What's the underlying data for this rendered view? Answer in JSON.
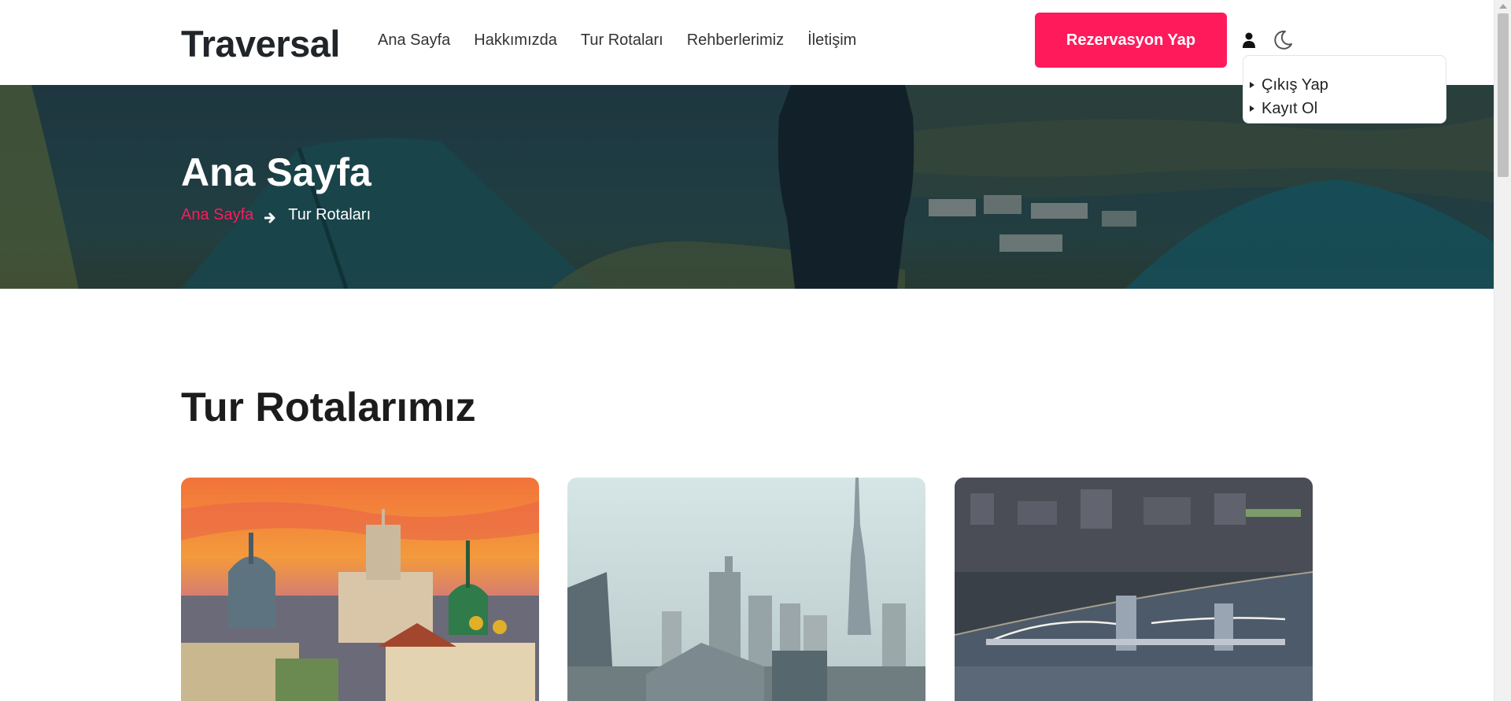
{
  "brand": {
    "name": "Traversal"
  },
  "nav": {
    "links": [
      {
        "label": "Ana Sayfa"
      },
      {
        "label": "Hakkımızda"
      },
      {
        "label": "Tur Rotaları"
      },
      {
        "label": "Rehberlerimiz"
      },
      {
        "label": "İletişim"
      }
    ],
    "reserve_label": "Rezervasyon Yap",
    "user_icon": "user-icon",
    "theme_icon": "moon-icon"
  },
  "user_menu": {
    "items": [
      {
        "label": "Çıkış Yap"
      },
      {
        "label": "Kayıt Ol"
      }
    ]
  },
  "hero": {
    "title": "Ana Sayfa",
    "breadcrumb": {
      "home": "Ana Sayfa",
      "current": "Tur Rotaları",
      "separator_icon": "arrow-right-icon"
    }
  },
  "section": {
    "title": "Tur Rotalarımız"
  },
  "tour_cards": [
    {
      "image": "city-sunset-domes-photo"
    },
    {
      "image": "skyscraper-skyline-photo"
    },
    {
      "image": "bridge-river-night-photo"
    }
  ],
  "colors": {
    "accent": "#ff1a5c",
    "hero_overlay": "#27434c",
    "text_dark": "#212529"
  }
}
